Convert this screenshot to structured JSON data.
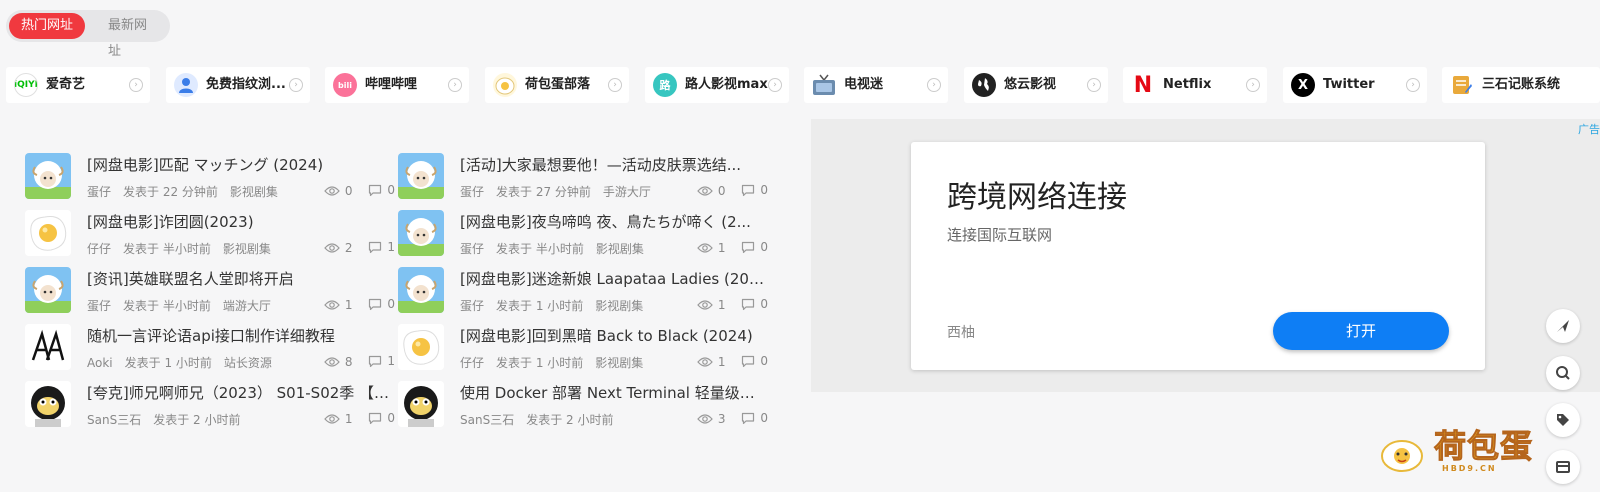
{
  "tabs": {
    "hot": "热门网址",
    "new": "最新网址"
  },
  "sites": [
    {
      "name": "爱奇艺",
      "icon": "iqiyi-icon",
      "badge": "iQIYI",
      "color": "#00be06"
    },
    {
      "name": "免费指纹浏...",
      "icon": "fingerprint-icon",
      "badge": "",
      "color": "#3b7de8"
    },
    {
      "name": "哔哩哔哩",
      "icon": "bilibili-icon",
      "badge": "bili",
      "color": "#fb7299"
    },
    {
      "name": "荷包蛋部落",
      "icon": "egg-icon",
      "badge": "",
      "color": "#f6c343"
    },
    {
      "name": "路人影视max",
      "icon": "lu-icon",
      "badge": "路",
      "color": "#37c6c0"
    },
    {
      "name": "电视迷",
      "icon": "tv-icon",
      "badge": "",
      "color": "#6b8cae"
    },
    {
      "name": "悠云影视",
      "icon": "globe-icon",
      "badge": "",
      "color": "#222222"
    },
    {
      "name": "Netflix",
      "icon": "netflix-icon",
      "badge": "N",
      "color": "#e50914"
    },
    {
      "name": "Twitter",
      "icon": "x-icon",
      "badge": "X",
      "color": "#000000"
    },
    {
      "name": "三石记账系统",
      "icon": "ledger-icon",
      "badge": "",
      "color": "#e9a93b"
    }
  ],
  "posts": [
    {
      "title": "[网盘电影]匹配 マッチング (2024)",
      "author": "蛋仔",
      "time": "发表于 22 分钟前",
      "category": "影视剧集",
      "views": "0",
      "comments": "0",
      "avatar": "sheep"
    },
    {
      "title": "[网盘电影]诈团圆(2023)",
      "author": "仔仔",
      "time": "发表于 半小时前",
      "category": "影视剧集",
      "views": "2",
      "comments": "1",
      "avatar": "egg"
    },
    {
      "title": "[资讯]英雄联盟名人堂即将开启",
      "author": "蛋仔",
      "time": "发表于 半小时前",
      "category": "端游大厅",
      "views": "1",
      "comments": "0",
      "avatar": "sheep"
    },
    {
      "title": "随机一言评论语api接口制作详细教程",
      "author": "Aoki",
      "time": "发表于 1 小时前",
      "category": "站长资源",
      "views": "8",
      "comments": "1",
      "avatar": "aa"
    },
    {
      "title": "[夸克]师兄啊师兄（2023） S01-S02季 【4...",
      "author": "SanS三石",
      "time": "发表于 2 小时前",
      "category": "",
      "views": "1",
      "comments": "0",
      "avatar": "monkey"
    },
    {
      "title": "[活动]大家最想要他！—活动皮肤票选结...",
      "author": "蛋仔",
      "time": "发表于 27 分钟前",
      "category": "手游大厅",
      "views": "0",
      "comments": "0",
      "avatar": "sheep"
    },
    {
      "title": "[网盘电影]夜鸟啼鸣 夜、鳥たちが啼く (2...",
      "author": "蛋仔",
      "time": "发表于 半小时前",
      "category": "影视剧集",
      "views": "1",
      "comments": "0",
      "avatar": "sheep"
    },
    {
      "title": "[网盘电影]迷途新娘 Laapataa Ladies (2023)",
      "author": "蛋仔",
      "time": "发表于 1 小时前",
      "category": "影视剧集",
      "views": "1",
      "comments": "0",
      "avatar": "sheep"
    },
    {
      "title": "[网盘电影]回到黑暗 Back to Black (2024)",
      "author": "仔仔",
      "time": "发表于 1 小时前",
      "category": "影视剧集",
      "views": "1",
      "comments": "0",
      "avatar": "egg"
    },
    {
      "title": "使用 Docker 部署 Next Terminal 轻量级堡...",
      "author": "SanS三石",
      "time": "发表于 2 小时前",
      "category": "",
      "views": "3",
      "comments": "0",
      "avatar": "monkey"
    }
  ],
  "ad": {
    "label": "广告",
    "title": "跨境网络连接",
    "subtitle": "连接国际互联网",
    "brand": "西柚",
    "button": "打开"
  },
  "logo": {
    "text": "荷包蛋",
    "domain": "HBD9.CN"
  }
}
